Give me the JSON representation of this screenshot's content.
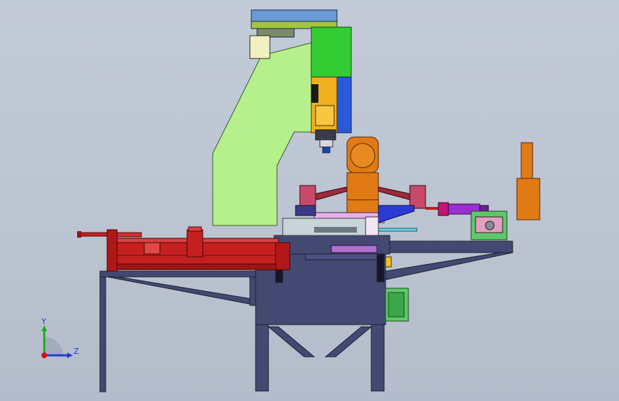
{
  "axes": {
    "y_label": "Y",
    "z_label": "Z",
    "y_color": "#22aa22",
    "z_color": "#1f3fd6",
    "origin_color": "#d01010"
  },
  "colors": {
    "background": "#bfc6d3",
    "frame": "#434971",
    "rail": "#c42020",
    "rail_dark": "#8e1414",
    "column_light_green": "#b6f08c",
    "spindle_green": "#33cc33",
    "spindle_blue": "#2a5ad6",
    "spindle_yellow": "#f0b020",
    "robot_orange": "#e07a14",
    "fixture_pink": "#e6b0e8",
    "fixture_purple": "#9a30d0",
    "fixture_cyan": "#6ad6e8",
    "guard_green": "#5ec86a"
  }
}
